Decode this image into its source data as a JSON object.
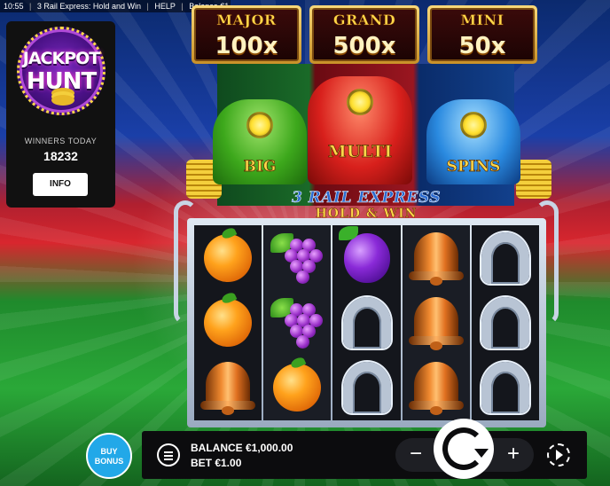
{
  "topbar": {
    "time": "10:55",
    "game_title": "3 Rail Express: Hold and Win",
    "help": "HELP",
    "balance": "Balance €1,000.00"
  },
  "jackpot_hunt": {
    "logo_line1": "JACKPOT",
    "logo_line2": "HUNT",
    "winners_label": "WINNERS TODAY",
    "winners_count": "18232",
    "info_label": "INFO"
  },
  "jackpots": [
    {
      "name": "MAJOR",
      "multiplier": "100x"
    },
    {
      "name": "GRAND",
      "multiplier": "500x"
    },
    {
      "name": "MINI",
      "multiplier": "50x"
    }
  ],
  "trains": [
    {
      "label": "BIG",
      "color": "green"
    },
    {
      "label": "MULTI",
      "color": "red"
    },
    {
      "label": "SPINS",
      "color": "blue"
    }
  ],
  "game_logo": {
    "line1": "3 RAIL EXPRESS",
    "line2": "HOLD & WIN"
  },
  "reels": [
    [
      "orange",
      "orange",
      "bell"
    ],
    [
      "grapes",
      "grapes",
      "orange"
    ],
    [
      "plum",
      "horseshoe",
      "horseshoe"
    ],
    [
      "bell",
      "bell",
      "bell"
    ],
    [
      "horseshoe",
      "horseshoe",
      "horseshoe"
    ]
  ],
  "bottom_bar": {
    "buy_bonus_line1": "BUY",
    "buy_bonus_line2": "BONUS",
    "balance_text": "BALANCE €1,000.00",
    "bet_text": "BET €1.00",
    "minus": "−",
    "plus": "+",
    "menu_icon": "hamburger-menu-icon",
    "spin_icon": "spin-arrow-icon",
    "autoplay_icon": "autoplay-icon"
  }
}
